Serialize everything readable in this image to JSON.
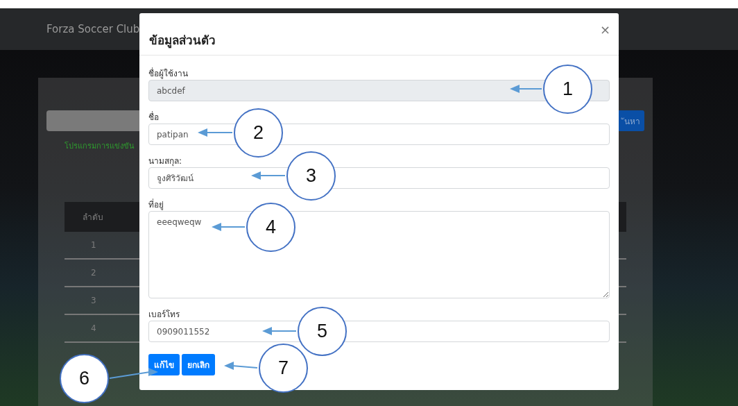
{
  "navbar": {
    "brand": "Forza Soccer Club"
  },
  "background_page": {
    "search_button": "ันหา",
    "program_link": "โปรแกรมการแข่งขัน",
    "table": {
      "columns": [
        "ลำดับ"
      ],
      "rows": [
        "1",
        "2",
        "3",
        "4"
      ]
    }
  },
  "modal": {
    "title": "ข้อมูลส่วนตัว",
    "close": "×",
    "fields": [
      {
        "label": "ชื่อผู้ใช้งาน",
        "value": "abcdef",
        "kind": "input",
        "disabled": true
      },
      {
        "label": "ชื่อ",
        "value": "patipan",
        "kind": "input",
        "disabled": false
      },
      {
        "label": "นามสกุล:",
        "value": "จูงศิริวัฒน์",
        "kind": "input",
        "disabled": false
      },
      {
        "label": "ที่อยู่",
        "value": "eeeqweqw",
        "kind": "textarea",
        "disabled": false
      },
      {
        "label": "เบอร์โทร",
        "value": "0909011552",
        "kind": "input",
        "disabled": false
      }
    ],
    "buttons": [
      "แก้ไข",
      "ยกเลิก"
    ]
  },
  "callouts": [
    "1",
    "2",
    "3",
    "4",
    "5",
    "6",
    "7"
  ]
}
